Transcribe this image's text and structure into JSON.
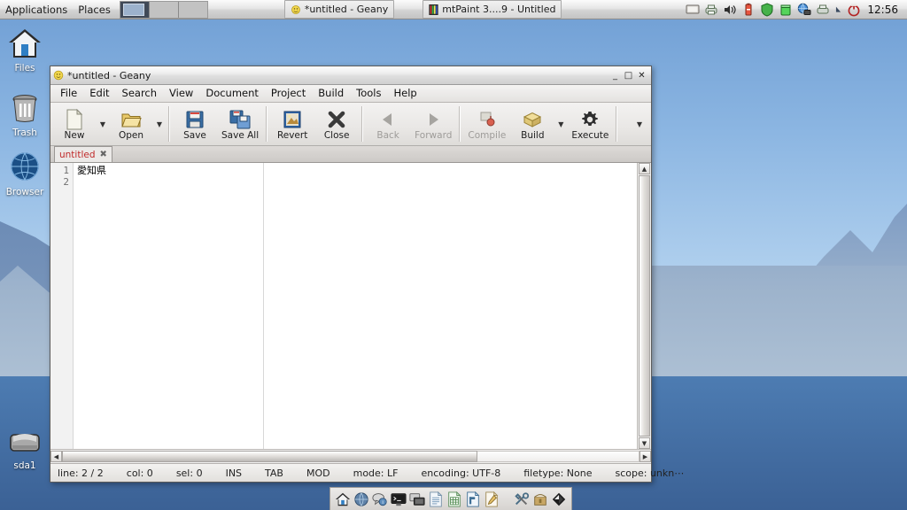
{
  "taskbar": {
    "applications_label": "Applications",
    "places_label": "Places",
    "workspaces": [
      "workspace-1",
      "workspace-2",
      "workspace-3"
    ],
    "active_workspace_index": 0,
    "windows": [
      {
        "icon": "geany-icon",
        "title": "*untitled - Geany"
      },
      {
        "icon": "mtpaint-icon",
        "title": "mtPaint 3....9 - Untitled"
      }
    ],
    "tray_icons": [
      "display-icon",
      "printer-icon",
      "volume-icon",
      "battery-icon",
      "shield-icon",
      "updates-icon",
      "network-icon",
      "disk-icon",
      "arrow-icon"
    ],
    "power_icon": "power-icon",
    "clock": "12:56"
  },
  "desktop_icons": [
    {
      "name": "files-icon",
      "label": "Files"
    },
    {
      "name": "trash-icon",
      "label": "Trash"
    },
    {
      "name": "browser-icon",
      "label": "Browser"
    },
    {
      "name": "drive-icon",
      "label": "sda1"
    }
  ],
  "geany": {
    "window_icon": "geany-icon",
    "title": "*untitled - Geany",
    "window_buttons": {
      "minimize": "minimize-icon",
      "maximize": "maximize-icon",
      "close": "close-icon"
    },
    "menu": [
      "File",
      "Edit",
      "Search",
      "View",
      "Document",
      "Project",
      "Build",
      "Tools",
      "Help"
    ],
    "toolbar": [
      {
        "label": "New",
        "icon": "new-file-icon",
        "enabled": true,
        "dropdown": true
      },
      {
        "label": "Open",
        "icon": "open-folder-icon",
        "enabled": true,
        "dropdown": true
      },
      {
        "separator": true
      },
      {
        "label": "Save",
        "icon": "save-icon",
        "enabled": true,
        "dropdown": false
      },
      {
        "label": "Save All",
        "icon": "save-all-icon",
        "enabled": true,
        "dropdown": false
      },
      {
        "separator": true
      },
      {
        "label": "Revert",
        "icon": "revert-icon",
        "enabled": true,
        "dropdown": false
      },
      {
        "label": "Close",
        "icon": "close-x-icon",
        "enabled": true,
        "dropdown": false
      },
      {
        "separator": true
      },
      {
        "label": "Back",
        "icon": "back-arrow-icon",
        "enabled": false,
        "dropdown": false
      },
      {
        "label": "Forward",
        "icon": "forward-arrow-icon",
        "enabled": false,
        "dropdown": false
      },
      {
        "separator": true
      },
      {
        "label": "Compile",
        "icon": "compile-icon",
        "enabled": false,
        "dropdown": false
      },
      {
        "label": "Build",
        "icon": "build-icon",
        "enabled": true,
        "dropdown": true
      },
      {
        "label": "Execute",
        "icon": "execute-gear-icon",
        "enabled": true,
        "dropdown": false
      },
      {
        "separator": true
      }
    ],
    "toolbar_overflow_icon": "chevron-down-icon",
    "document_tab": {
      "label": "untitled",
      "close_icon": "tab-close-icon"
    },
    "editor": {
      "line_numbers": [
        "1",
        "2"
      ],
      "lines": [
        "愛知県",
        ""
      ]
    },
    "statusbar": [
      "line: 2 / 2",
      "col: 0",
      "sel: 0",
      "INS",
      "TAB",
      "MOD",
      "mode: LF",
      "encoding: UTF-8",
      "filetype: None",
      "scope: unkn⋯"
    ]
  },
  "dock": {
    "items": [
      "home-icon",
      "browser-globe-icon",
      "chat-icon",
      "terminal-icon",
      "remote-desktop-icon",
      "text-document-icon",
      "spreadsheet-icon",
      "presentation-icon",
      "editor-pencil-icon"
    ],
    "items_right": [
      "tools-icon",
      "package-icon",
      "gimp-icon"
    ]
  },
  "colors": {
    "accent": "#4a78ae",
    "tab_text": "#c02a2a",
    "desktop_sky": "#8cb6e2",
    "desktop_water": "#4a78ae"
  }
}
